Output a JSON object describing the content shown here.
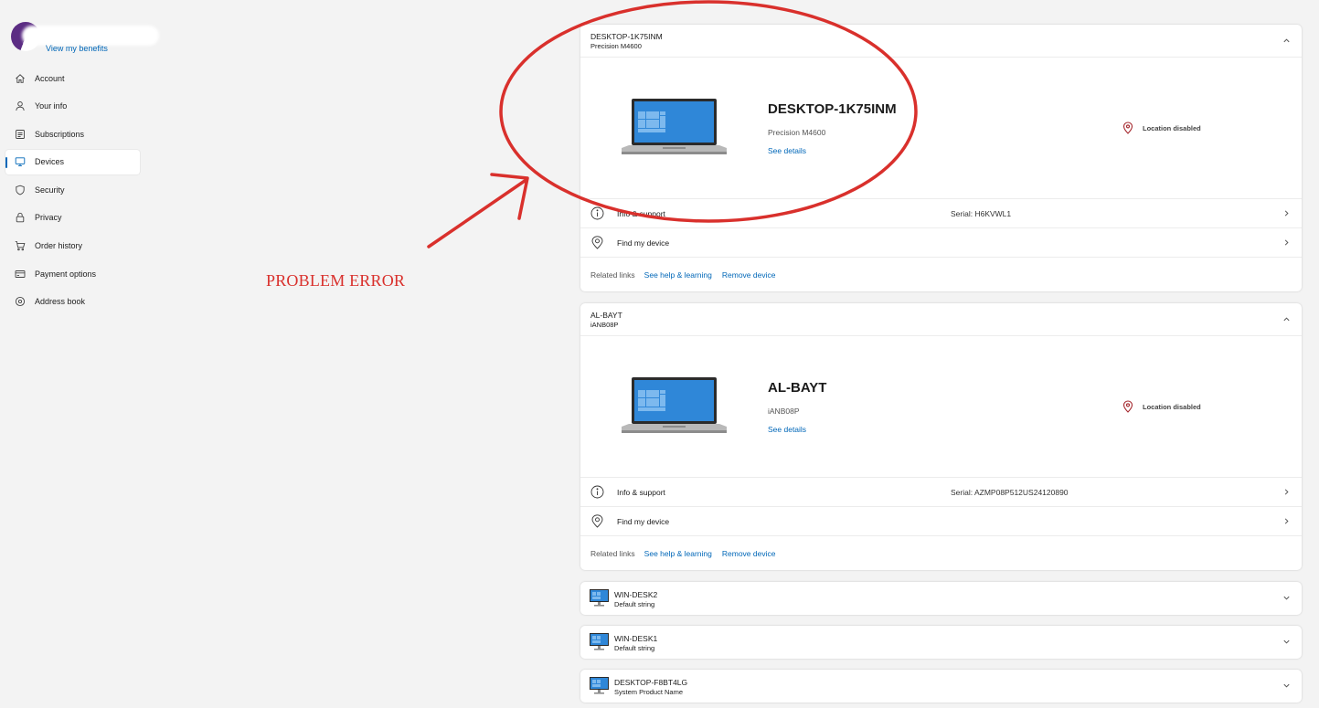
{
  "sidebar": {
    "benefits_link": "View my benefits",
    "items": [
      {
        "label": "Account",
        "icon": "home-icon",
        "active": false
      },
      {
        "label": "Your info",
        "icon": "person-icon",
        "active": false
      },
      {
        "label": "Subscriptions",
        "icon": "subscriptions-icon",
        "active": false
      },
      {
        "label": "Devices",
        "icon": "monitor-icon",
        "active": true
      },
      {
        "label": "Security",
        "icon": "shield-icon",
        "active": false
      },
      {
        "label": "Privacy",
        "icon": "lock-icon",
        "active": false
      },
      {
        "label": "Order history",
        "icon": "cart-icon",
        "active": false
      },
      {
        "label": "Payment options",
        "icon": "card-icon",
        "active": false
      },
      {
        "label": "Address book",
        "icon": "location-pin-icon",
        "active": false
      }
    ]
  },
  "annotation": {
    "label": "PROBLEM ERROR",
    "color": "#d9302c"
  },
  "devices": [
    {
      "header_name": "DESKTOP-1K75INM",
      "header_model": "Precision M4600",
      "title": "DESKTOP-1K75INM",
      "model": "Precision M4600",
      "see_details": "See details",
      "location": "Location disabled",
      "info_support": "Info & support",
      "serial": "Serial: H6KVWL1",
      "find_device": "Find my device",
      "related_label": "Related links",
      "help_link": "See help & learning",
      "remove_link": "Remove device"
    },
    {
      "header_name": "AL-BAYT",
      "header_model": "iANB08P",
      "title": "AL-BAYT",
      "model": "iANB08P",
      "see_details": "See details",
      "location": "Location disabled",
      "info_support": "Info & support",
      "serial": "Serial: AZMP08P512US24120890",
      "find_device": "Find my device",
      "related_label": "Related links",
      "help_link": "See help & learning",
      "remove_link": "Remove device"
    }
  ],
  "collapsed_devices": [
    {
      "name": "WIN-DESK2",
      "model": "Default string"
    },
    {
      "name": "WIN-DESK1",
      "model": "Default string"
    },
    {
      "name": "DESKTOP-F8BT4LG",
      "model": "System Product Name"
    }
  ],
  "colors": {
    "accent": "#0067b8",
    "annotation_red": "#d9302c",
    "screen_blue": "#2f87d8"
  }
}
